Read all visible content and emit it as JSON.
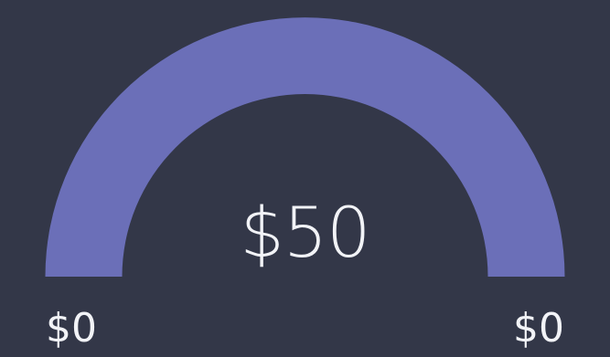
{
  "chart_data": {
    "type": "gauge",
    "value": 50,
    "value_label": "$50",
    "min": 0,
    "max": 0,
    "min_label": "$0",
    "max_label": "$0",
    "colors": {
      "background": "#333748",
      "arc": "#6b6fb8",
      "text": "#f2f3f7"
    }
  }
}
